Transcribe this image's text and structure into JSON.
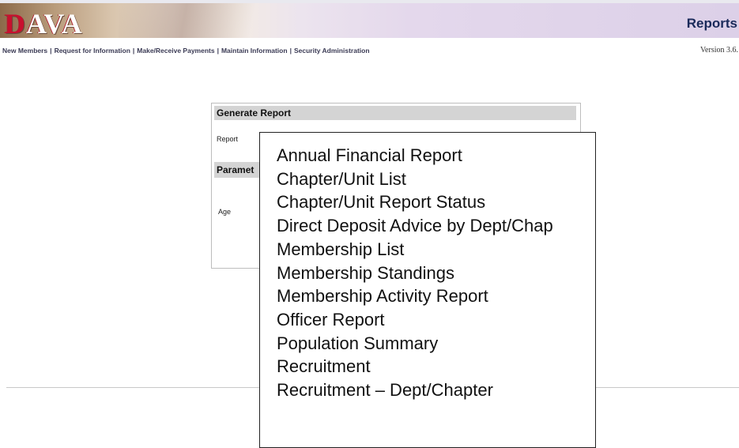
{
  "app": {
    "logo_text": "DAVA",
    "section_title": "Reports",
    "version": "Version 3.6."
  },
  "nav": {
    "items": [
      {
        "label": "New Members"
      },
      {
        "label": "Request for Information"
      },
      {
        "label": "Make/Receive Payments"
      },
      {
        "label": "Maintain Information"
      },
      {
        "label": "Security Administration"
      }
    ],
    "separator": "|"
  },
  "form": {
    "title": "Generate Report",
    "report_label": "Report",
    "parameters_title": "Paramet",
    "age_label": "Age"
  },
  "report_dropdown": {
    "options": [
      "Annual Financial Report",
      "Chapter/Unit List",
      "Chapter/Unit Report Status",
      "Direct Deposit Advice by Dept/Chap",
      "Membership List",
      "Membership Standings",
      "Membership Activity Report",
      "Officer Report",
      "Population Summary",
      "Recruitment",
      "Recruitment – Dept/Chapter"
    ]
  },
  "colors": {
    "brand_red": "#c8102e",
    "title_navy": "#1a2a5a",
    "panel_header_gray": "#d4d4d4"
  }
}
